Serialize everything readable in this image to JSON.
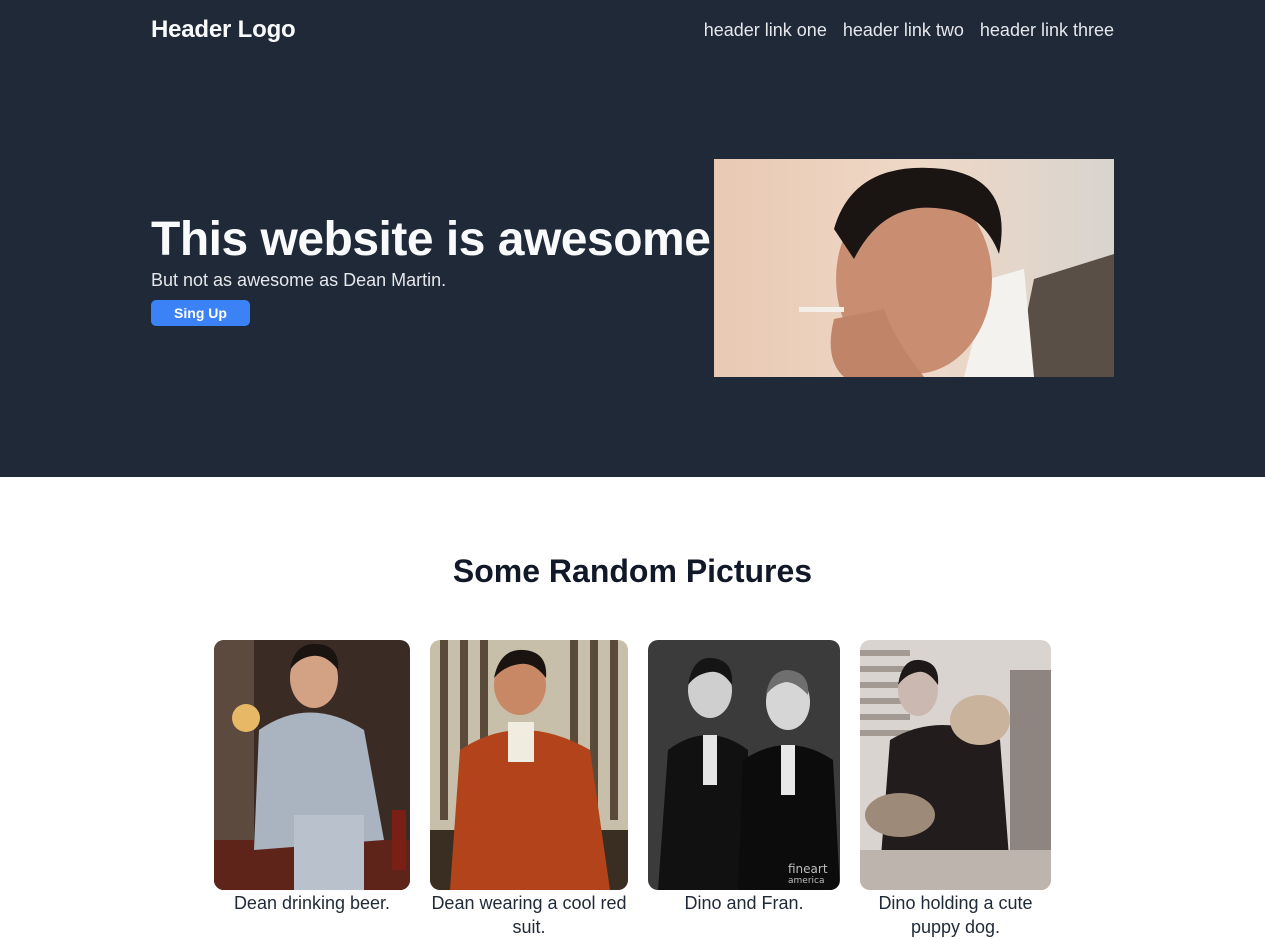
{
  "header": {
    "logo": "Header Logo",
    "links": [
      "header link one",
      "header link two",
      "header link three"
    ]
  },
  "hero": {
    "title": "This website is awesome",
    "subtitle": "But not as awesome as Dean Martin.",
    "cta_label": "Sing Up"
  },
  "gallery": {
    "title": "Some Random Pictures",
    "items": [
      {
        "caption": "Dean drinking beer."
      },
      {
        "caption": "Dean wearing a cool red suit."
      },
      {
        "caption": "Dino and Fran."
      },
      {
        "caption": "Dino holding a cute puppy dog."
      }
    ]
  },
  "colors": {
    "hero_bg": "#1f2937",
    "accent": "#3b82f6"
  }
}
